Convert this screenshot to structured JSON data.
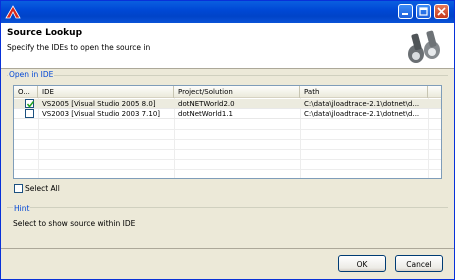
{
  "window": {
    "title": ""
  },
  "header": {
    "title": "Source Lookup",
    "description": "Specify the IDEs to open the source in",
    "icon": "binoculars-icon"
  },
  "open_in_ide": {
    "group_label": "Open in IDE",
    "columns": [
      "O...",
      "IDE",
      "Project/Solution",
      "Path"
    ],
    "rows": [
      {
        "checked": true,
        "ide": "VS2005 [Visual Studio 2005 8.0]",
        "project": "dotNETWorld2.0",
        "path": "C:\\data\\jloadtrace-2.1\\dotnet\\d..."
      },
      {
        "checked": false,
        "ide": "VS2003 [Visual Studio 2003 7.10]",
        "project": "dotNetWorld1.1",
        "path": "C:\\data\\jloadtrace-2.1\\dotnet\\d..."
      }
    ],
    "select_all_label": "Select All",
    "select_all_checked": false
  },
  "hint": {
    "label": "Hint",
    "text": "Select to show source within IDE"
  },
  "buttons": {
    "ok": "OK",
    "cancel": "Cancel"
  },
  "colors": {
    "titlebar": "#0049d6",
    "group_label": "#0046d5",
    "dialog_bg": "#ece9d8"
  }
}
